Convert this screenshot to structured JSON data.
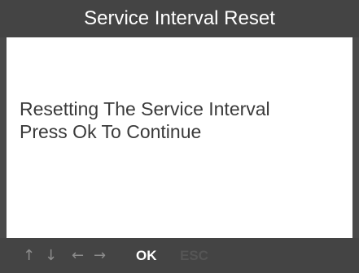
{
  "screen": {
    "title": "Service Interval Reset",
    "message_lines": [
      "Resetting The Service Interval",
      "Press Ok To Continue"
    ]
  },
  "footer": {
    "keys": {
      "up": "↑",
      "down": "↓",
      "left": "←",
      "right": "→",
      "ok": "OK",
      "esc": "ESC"
    },
    "key_icons": [
      "up-arrow-icon",
      "down-arrow-icon",
      "left-arrow-icon",
      "right-arrow-icon"
    ],
    "active_color": "#ffffff",
    "inactive_color": "#555555",
    "arrow_color": "#8c8c8c"
  }
}
